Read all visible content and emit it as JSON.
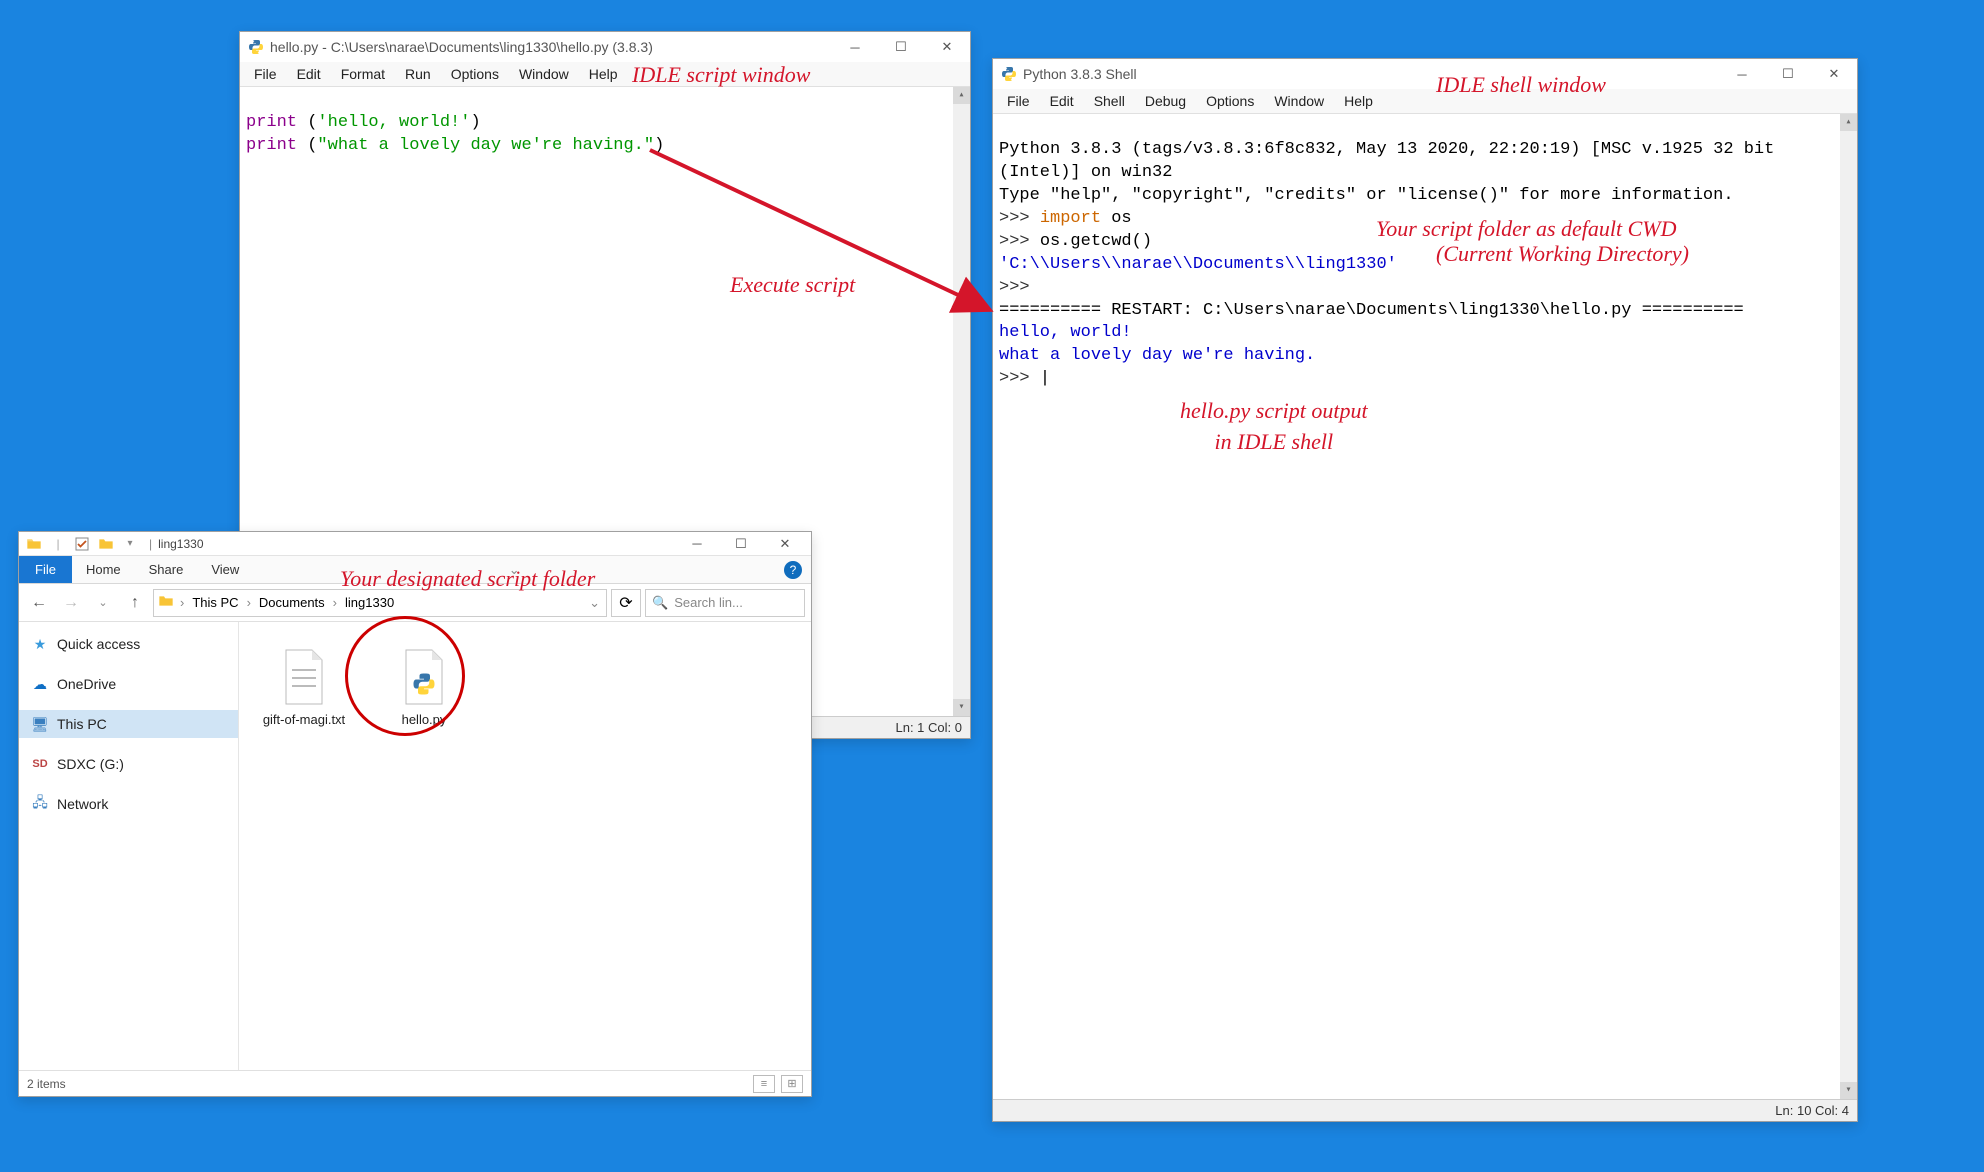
{
  "script_window": {
    "title": "hello.py - C:\\Users\\narae\\Documents\\ling1330\\hello.py (3.8.3)",
    "menu": [
      "File",
      "Edit",
      "Format",
      "Run",
      "Options",
      "Window",
      "Help"
    ],
    "line1_func": "print",
    "line1_open": " (",
    "line1_str": "'hello, world!'",
    "line1_close": ")",
    "line2_func": "print",
    "line2_open": " (",
    "line2_str": "\"what a lovely day we're having.\"",
    "line2_close": ")",
    "status": "Ln: 1  Col: 0"
  },
  "shell_window": {
    "title": "Python 3.8.3 Shell",
    "menu": [
      "File",
      "Edit",
      "Shell",
      "Debug",
      "Options",
      "Window",
      "Help"
    ],
    "banner1": "Python 3.8.3 (tags/v3.8.3:6f8c832, May 13 2020, 22:20:19) [MSC v.1925 32 bit (Intel)] on win32",
    "banner2": "Type \"help\", \"copyright\", \"credits\" or \"license()\" for more information.",
    "p1_prompt": ">>> ",
    "p1_import": "import",
    "p1_rest": " os",
    "p2_prompt": ">>> ",
    "p2_cmd": "os.getcwd()",
    "p3_result": "'C:\\\\Users\\\\narae\\\\Documents\\\\ling1330'",
    "p4_prompt": ">>> ",
    "restart": "========== RESTART: C:\\Users\\narae\\Documents\\ling1330\\hello.py ==========",
    "out1": "hello, world!",
    "out2": "what a lovely day we're having.",
    "p5_prompt": ">>> ",
    "cursor": "|",
    "status": "Ln: 10  Col: 4"
  },
  "explorer": {
    "qat_title": "ling1330",
    "tabs": {
      "file": "File",
      "home": "Home",
      "share": "Share",
      "view": "View"
    },
    "breadcrumb": [
      "This PC",
      "Documents",
      "ling1330"
    ],
    "search_placeholder": "Search lin...",
    "sidebar": {
      "quick": "Quick access",
      "onedrive": "OneDrive",
      "thispc": "This PC",
      "sdxc": "SDXC (G:)",
      "network": "Network"
    },
    "files": [
      {
        "name": "gift-of-magi.txt"
      },
      {
        "name": "hello.py"
      }
    ],
    "status": "2 items"
  },
  "annotations": {
    "script_label": "IDLE script window",
    "execute_label": "Execute script",
    "shell_label": "IDLE shell window",
    "cwd_label1": "Your script folder as default CWD",
    "cwd_label2": "(Current Working Directory)",
    "output_label1": "hello.py script output",
    "output_label2": "in IDLE shell",
    "folder_label": "Your designated script folder"
  }
}
